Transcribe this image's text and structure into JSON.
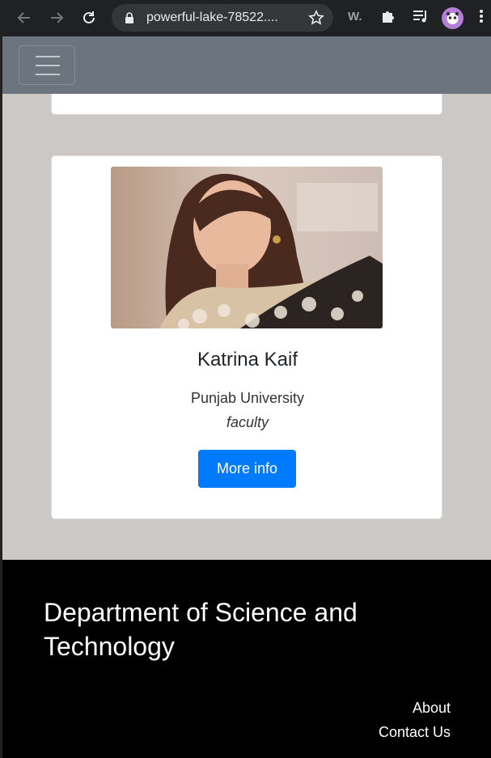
{
  "browser": {
    "url": "powerful-lake-78522....",
    "extension_label": "W."
  },
  "navbar": {
    "toggler_icon": "hamburger-icon"
  },
  "card": {
    "name": "Katrina Kaif",
    "university": "Punjab University",
    "role": "faculty",
    "button_label": "More info"
  },
  "footer": {
    "title": "Department of Science and Technology",
    "links": [
      "About",
      "Contact Us"
    ]
  },
  "colors": {
    "navbar": "#6c757d",
    "page_bg": "#cbc8c5",
    "button": "#007bff",
    "footer": "#000000"
  }
}
